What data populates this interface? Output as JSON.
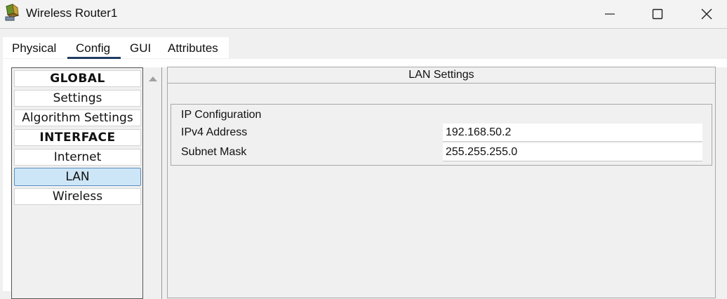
{
  "window": {
    "title": "Wireless Router1",
    "icons": {
      "app": "router-icon",
      "minimize": "minimize-icon",
      "maximize": "maximize-icon",
      "close": "close-icon"
    }
  },
  "tabs": [
    {
      "label": "Physical",
      "active": false
    },
    {
      "label": "Config",
      "active": true
    },
    {
      "label": "GUI",
      "active": false
    },
    {
      "label": "Attributes",
      "active": false
    }
  ],
  "nav": {
    "items": [
      {
        "label": "GLOBAL",
        "type": "header"
      },
      {
        "label": "Settings",
        "type": "item"
      },
      {
        "label": "Algorithm Settings",
        "type": "item"
      },
      {
        "label": "INTERFACE",
        "type": "header"
      },
      {
        "label": "Internet",
        "type": "item"
      },
      {
        "label": "LAN",
        "type": "item",
        "selected": true
      },
      {
        "label": "Wireless",
        "type": "item"
      }
    ]
  },
  "lan": {
    "title": "LAN Settings",
    "group_title": "IP Configuration",
    "ipv4_label": "IPv4 Address",
    "ipv4_value": "192.168.50.2",
    "mask_label": "Subnet Mask",
    "mask_value": "255.255.255.0"
  },
  "colors": {
    "selected_bg": "#cde6f7",
    "selected_border": "#5b8fc0",
    "tab_underline": "#1f3b63"
  }
}
